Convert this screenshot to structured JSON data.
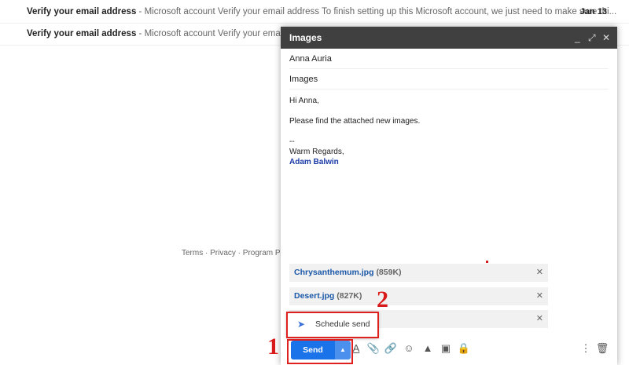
{
  "inbox": [
    {
      "subject": "Verify your email address",
      "snippet": " - Microsoft account Verify your email address To finish setting up this Microsoft account, we just need to make sure thi...",
      "date": "Jan 13"
    },
    {
      "subject": "Verify your email address",
      "snippet": " - Microsoft account Verify your email address",
      "date": ""
    }
  ],
  "footer": "Terms · Privacy · Program Polic",
  "compose": {
    "title": "Images",
    "minimize": "_",
    "expand": "⤢",
    "close": "✕",
    "to": "Anna Auria",
    "subject": "Images",
    "body": {
      "greeting": "Hi Anna,",
      "message": "Please find the attached new images.",
      "sig_sep": "--",
      "closing": "Warm Regards,",
      "signature": "Adam Balwin"
    },
    "attachments": [
      {
        "name": "Chrysanthemum.jpg",
        "size": "(859K)"
      },
      {
        "name": "Desert.jpg",
        "size": "(827K)"
      },
      {
        "name": "",
        "size": ""
      }
    ],
    "schedule_send": "Schedule send",
    "send": "Send",
    "accent": "#1a73e8"
  },
  "annotations": {
    "step1": "1",
    "step2": "2",
    "color": "#e0201f"
  }
}
